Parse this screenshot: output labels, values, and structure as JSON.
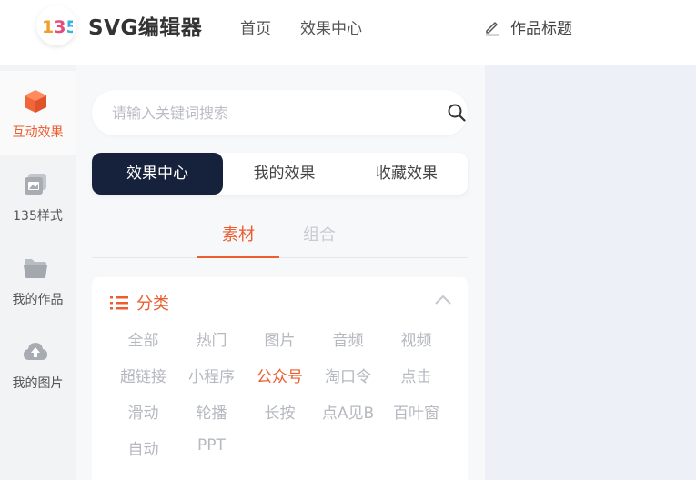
{
  "header": {
    "logo_text": "135",
    "brand": "SVG编辑器",
    "nav": [
      "首页",
      "效果中心"
    ],
    "title_label": "作品标题"
  },
  "sidebar": {
    "items": [
      {
        "label": "互动效果",
        "icon": "cube-icon",
        "active": true
      },
      {
        "label": "135样式",
        "icon": "gallery-icon",
        "active": false
      },
      {
        "label": "我的作品",
        "icon": "folder-icon",
        "active": false
      },
      {
        "label": "我的图片",
        "icon": "cloud-upload-icon",
        "active": false
      }
    ]
  },
  "search": {
    "placeholder": "请输入关键词搜索",
    "value": ""
  },
  "tabs": [
    "效果中心",
    "我的效果",
    "收藏效果"
  ],
  "active_tab": "效果中心",
  "subtabs": [
    "素材",
    "组合"
  ],
  "active_subtab": "素材",
  "category": {
    "title": "分类",
    "selected": "公众号",
    "items": [
      "全部",
      "热门",
      "图片",
      "音频",
      "视频",
      "超链接",
      "小程序",
      "公众号",
      "淘口令",
      "点击",
      "滑动",
      "轮播",
      "长按",
      "点A见B",
      "百叶窗",
      "自动",
      "PPT"
    ]
  },
  "colors": {
    "accent": "#ec5d2f",
    "tab_active_bg": "#16213b",
    "muted_text": "#b6b9c0"
  }
}
